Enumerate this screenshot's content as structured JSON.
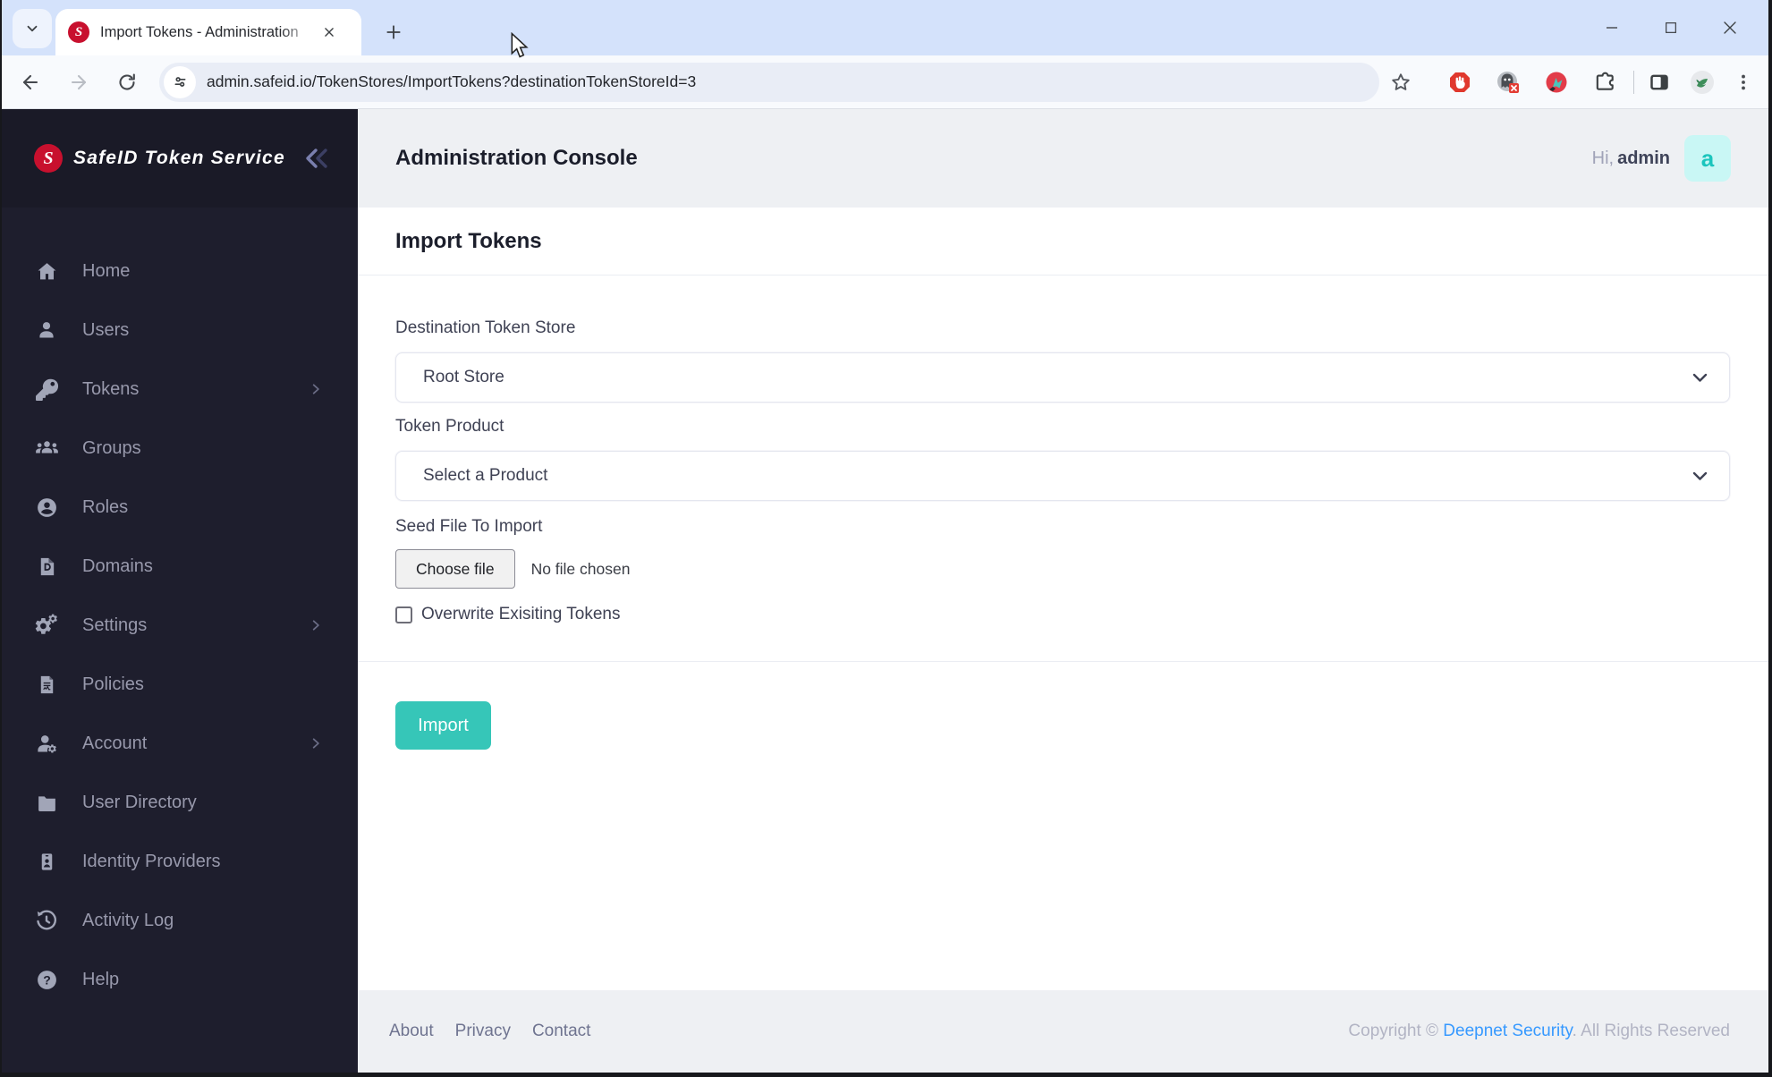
{
  "browser": {
    "tab_title": "Import Tokens - Administration",
    "url": "admin.safeid.io/TokenStores/ImportTokens?destinationTokenStoreId=3",
    "favicon_letter": "S"
  },
  "sidebar": {
    "brand": "SafeID Token Service",
    "brand_initial": "S",
    "items": [
      {
        "icon": "home-icon",
        "label": "Home",
        "submenu": false
      },
      {
        "icon": "user-icon",
        "label": "Users",
        "submenu": false
      },
      {
        "icon": "key-icon",
        "label": "Tokens",
        "submenu": true
      },
      {
        "icon": "groups-icon",
        "label": "Groups",
        "submenu": false
      },
      {
        "icon": "role-icon",
        "label": "Roles",
        "submenu": false
      },
      {
        "icon": "domain-icon",
        "label": "Domains",
        "submenu": false
      },
      {
        "icon": "gears-icon",
        "label": "Settings",
        "submenu": true
      },
      {
        "icon": "policy-icon",
        "label": "Policies",
        "submenu": false
      },
      {
        "icon": "account-gear-icon",
        "label": "Account",
        "submenu": true
      },
      {
        "icon": "folder-icon",
        "label": "User Directory",
        "submenu": false
      },
      {
        "icon": "id-card-icon",
        "label": "Identity Providers",
        "submenu": false
      },
      {
        "icon": "history-icon",
        "label": "Activity Log",
        "submenu": false
      },
      {
        "icon": "help-icon",
        "label": "Help",
        "submenu": false
      }
    ]
  },
  "header": {
    "title": "Administration Console",
    "greeting_prefix": "Hi,",
    "username": "admin",
    "avatar_letter": "a"
  },
  "page": {
    "title": "Import Tokens"
  },
  "form": {
    "destination_label": "Destination Token Store",
    "destination_value": "Root Store",
    "product_label": "Token Product",
    "product_value": "Select a Product",
    "seed_label": "Seed File To Import",
    "choose_file_label": "Choose file",
    "no_file_text": "No file chosen",
    "overwrite_label": "Overwrite Exisiting Tokens",
    "submit_label": "Import"
  },
  "footer": {
    "links": [
      {
        "label": "About"
      },
      {
        "label": "Privacy"
      },
      {
        "label": "Contact"
      }
    ],
    "copyright_prefix": "Copyright © ",
    "copyright_link": "Deepnet Security",
    "copyright_suffix": ". All Rights Reserved"
  },
  "colors": {
    "accent_teal": "#36c6b8",
    "avatar_bg": "#c9f7f5",
    "avatar_text": "#1bc5bd",
    "link_blue": "#3699ff",
    "brand_red": "#c8102e",
    "sidebar_bg": "#1e1e2d",
    "titlebar_blue": "#d4e2fb"
  }
}
